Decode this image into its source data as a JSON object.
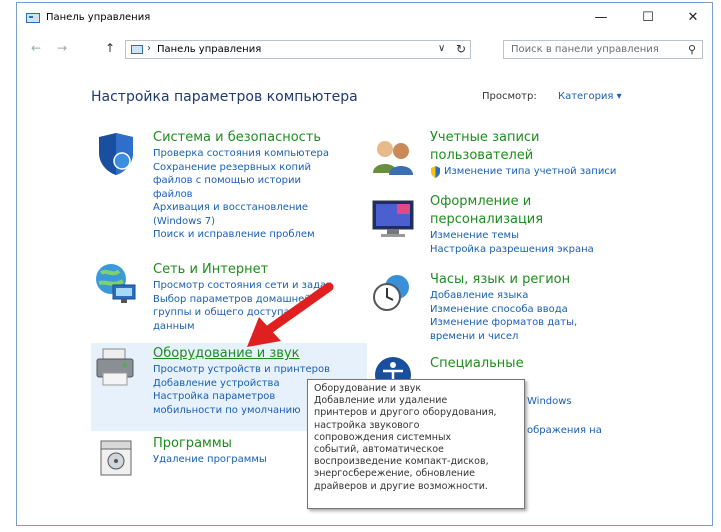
{
  "window": {
    "title": "Панель управления",
    "minimize": "—",
    "maximize": "☐",
    "close": "✕"
  },
  "nav": {
    "back": "←",
    "forward": "→",
    "up": "↑"
  },
  "address": {
    "separator": "›",
    "text": "Панель управления",
    "dropdown": "∨",
    "refresh": "↻"
  },
  "search": {
    "placeholder": "Поиск в панели управления",
    "icon": "⚲"
  },
  "main": {
    "heading": "Настройка параметров компьютера",
    "view_label": "Просмотр:",
    "view_value": "Категория ▾"
  },
  "categories": {
    "system": {
      "title": "Система и безопасность",
      "links": [
        "Проверка состояния компьютера",
        "Сохранение резервных копий",
        "файлов с помощью истории",
        "файлов",
        "Архивация и восстановление",
        "(Windows 7)",
        "Поиск и исправление проблем"
      ]
    },
    "network": {
      "title": "Сеть и Интернет",
      "links": [
        "Просмотр состояния сети и задач",
        "Выбор параметров домашней",
        "группы и общего доступа",
        "данным"
      ]
    },
    "hardware": {
      "title": "Оборудование и звук",
      "links": [
        "Просмотр устройств и принтеров",
        "Добавление устройства",
        "Настройка параметров",
        "мобильности по умолчанию"
      ]
    },
    "programs": {
      "title": "Программы",
      "links": [
        "Удаление программы"
      ]
    },
    "accounts": {
      "title_lines": [
        "Учетные записи",
        "пользователей"
      ],
      "links": [
        "Изменение типа учетной записи"
      ]
    },
    "appearance": {
      "title_lines": [
        "Оформление и",
        "персонализация"
      ],
      "links": [
        "Изменение темы",
        "Настройка разрешения экрана"
      ]
    },
    "clock": {
      "title": "Часы, язык и регион",
      "links": [
        "Добавление языка",
        "Изменение способа ввода",
        "Изменение форматов даты,",
        "времени и чисел"
      ]
    },
    "access": {
      "title": "Специальные",
      "links": [
        "Windows",
        "ображения на"
      ]
    }
  },
  "tooltip": {
    "lines": [
      "Оборудование и звук",
      "Добавление или удаление",
      "принтеров и другого оборудования,",
      "настройка звукового",
      "сопровождения системных",
      "событий, автоматическое",
      "воспроизведение компакт-дисков,",
      "энергосбережение, обновление",
      "драйверов и другие возможности."
    ]
  }
}
